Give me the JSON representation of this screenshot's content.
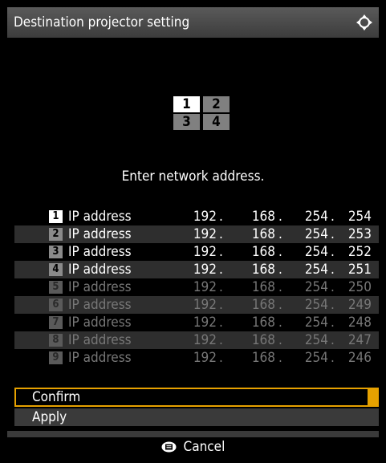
{
  "title": "Destination projector setting",
  "grid": {
    "cells": [
      "1",
      "2",
      "3",
      "4"
    ]
  },
  "prompt": "Enter network address.",
  "rows": [
    {
      "num": "1",
      "label": "IP address",
      "o1": "192",
      "o2": "168",
      "o3": "254",
      "o4": "254",
      "state": "active"
    },
    {
      "num": "2",
      "label": "IP address",
      "o1": "192",
      "o2": "168",
      "o3": "254",
      "o4": "253",
      "state": "gray"
    },
    {
      "num": "3",
      "label": "IP address",
      "o1": "192",
      "o2": "168",
      "o3": "254",
      "o4": "252",
      "state": "gray"
    },
    {
      "num": "4",
      "label": "IP address",
      "o1": "192",
      "o2": "168",
      "o3": "254",
      "o4": "251",
      "state": "gray"
    },
    {
      "num": "5",
      "label": "IP address",
      "o1": "192",
      "o2": "168",
      "o3": "254",
      "o4": "250",
      "state": "faded"
    },
    {
      "num": "6",
      "label": "IP address",
      "o1": "192",
      "o2": "168",
      "o3": "254",
      "o4": "249",
      "state": "faded"
    },
    {
      "num": "7",
      "label": "IP address",
      "o1": "192",
      "o2": "168",
      "o3": "254",
      "o4": "248",
      "state": "faded"
    },
    {
      "num": "8",
      "label": "IP address",
      "o1": "192",
      "o2": "168",
      "o3": "254",
      "o4": "247",
      "state": "faded"
    },
    {
      "num": "9",
      "label": "IP address",
      "o1": "192",
      "o2": "168",
      "o3": "254",
      "o4": "246",
      "state": "faded"
    }
  ],
  "confirm_label": "Confirm",
  "apply_label": "Apply",
  "footer": {
    "cancel_label": "Cancel",
    "cancel_icon": "menu-button-icon"
  },
  "colors": {
    "accent": "#e6a100",
    "titlebar": "#4a4a4a"
  }
}
